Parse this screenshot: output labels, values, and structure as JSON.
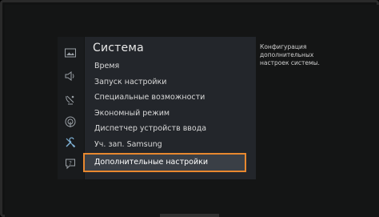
{
  "menu": {
    "title": "Система",
    "items": [
      {
        "label": "Время"
      },
      {
        "label": "Запуск настройки"
      },
      {
        "label": "Специальные возможности"
      },
      {
        "label": "Экономный режим"
      },
      {
        "label": "Диспетчер устройств ввода"
      },
      {
        "label": "Уч. зап. Samsung"
      },
      {
        "label": "Дополнительные настройки"
      }
    ],
    "selected_index": 6
  },
  "help": {
    "text": "Конфигурация дополнительных настроек системы."
  },
  "sidebar": {
    "icons": [
      "picture-icon",
      "sound-icon",
      "broadcast-icon",
      "network-icon",
      "system-tools-icon",
      "support-icon"
    ]
  },
  "colors": {
    "highlight_border": "#e8882f",
    "panel_background": "#23262b"
  }
}
